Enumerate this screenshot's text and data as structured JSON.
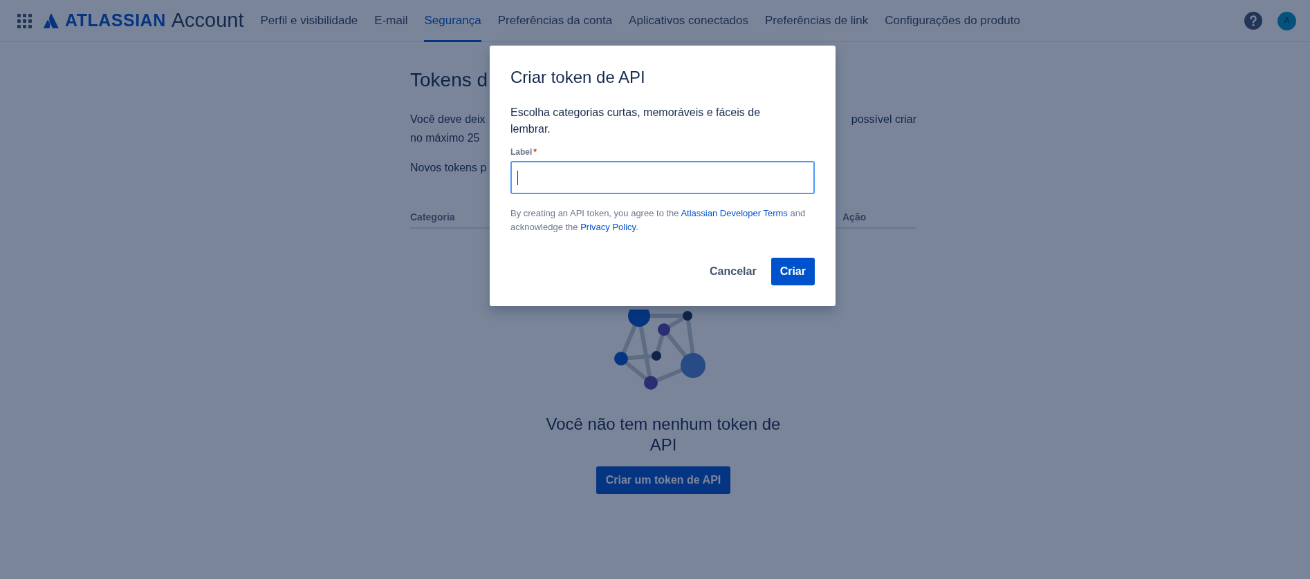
{
  "header": {
    "brand": "ATLASSIAN",
    "product": "Account",
    "nav": [
      {
        "label": "Perfil e visibilidade",
        "selected": false
      },
      {
        "label": "E-mail",
        "selected": false
      },
      {
        "label": "Segurança",
        "selected": true
      },
      {
        "label": "Preferências da conta",
        "selected": false
      },
      {
        "label": "Aplicativos conectados",
        "selected": false
      },
      {
        "label": "Preferências de link",
        "selected": false
      },
      {
        "label": "Configurações do produto",
        "selected": false
      }
    ],
    "avatar": "A"
  },
  "page": {
    "title": "Tokens d",
    "lines": [
      {
        "left": "Você deve deix",
        "right": "possível criar"
      },
      {
        "left": "no máximo 25"
      }
    ],
    "note": "Novos tokens p",
    "columns": [
      "Categoria",
      "Ação"
    ],
    "empty_title": "Você não tem nenhum token de API",
    "create_button": "Criar um token de API"
  },
  "dialog": {
    "title": "Criar token de API",
    "description": "Escolha categorias curtas, memoráveis e fáceis de lembrar.",
    "field": {
      "label": "Label",
      "required_mark": "*",
      "focused": true
    },
    "terms": [
      {
        "text": "By creating an API token, you agree to the "
      },
      {
        "text": "Atlassian Developer Terms",
        "link": true
      },
      {
        "text": " and acknowledge the "
      },
      {
        "text": "Privacy Policy",
        "link": true
      },
      {
        "text": "."
      }
    ],
    "buttons": [
      {
        "label": "Cancelar",
        "kind": "subtle"
      },
      {
        "label": "Criar",
        "kind": "primary"
      }
    ]
  }
}
